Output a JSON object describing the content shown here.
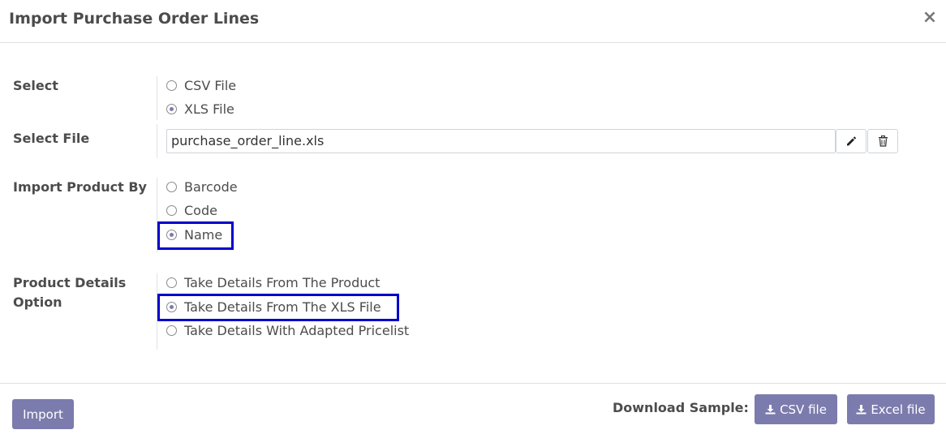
{
  "dialog": {
    "title": "Import Purchase Order Lines",
    "close_glyph": "×"
  },
  "select": {
    "label": "Select",
    "options": [
      {
        "label": "CSV File",
        "checked": false
      },
      {
        "label": "XLS File",
        "checked": true
      }
    ]
  },
  "select_file": {
    "label": "Select File",
    "value": "purchase_order_line.xls",
    "edit_icon": "pencil-icon",
    "delete_icon": "trash-icon"
  },
  "import_product_by": {
    "label": "Import Product By",
    "options": [
      {
        "label": "Barcode",
        "checked": false
      },
      {
        "label": "Code",
        "checked": false
      },
      {
        "label": "Name",
        "checked": true
      }
    ]
  },
  "product_details": {
    "label_line1": "Product Details",
    "label_line2": "Option",
    "options": [
      {
        "label": "Take Details From The Product",
        "checked": false
      },
      {
        "label": "Take Details From The XLS File",
        "checked": true
      },
      {
        "label": "Take Details With Adapted Pricelist",
        "checked": false
      }
    ]
  },
  "footer": {
    "import_label": "Import",
    "download_label": "Download Sample:",
    "csv_label": "CSV file",
    "excel_label": "Excel file",
    "download_icon": "download-icon"
  },
  "colors": {
    "accent": "#7c7bad",
    "highlight_border": "#0000cc"
  }
}
